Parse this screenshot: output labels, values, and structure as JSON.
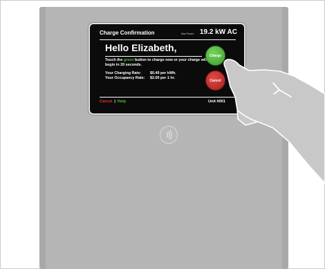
{
  "screen": {
    "title": "Charge Confirmation",
    "max_power_label": "Max Power:",
    "max_power_value": "19.2 kW AC",
    "greeting": "Hello Elizabeth,",
    "instruction_before": "Touch the ",
    "instruction_green": "green",
    "instruction_after": " button to charge now or your charge will begin in 20 seconds.",
    "charging_rate_label": "Your Charging Rate:",
    "charging_rate_value": "$0.49 per kWh.",
    "occupancy_rate_label": "Your Occupancy Rate:",
    "occupancy_rate_value": "$2.00 per 1 hr.",
    "charge_button": "Charge",
    "cancel_button": "Cancel",
    "footer_cancel": "Cancel",
    "footer_separator": "|",
    "footer_help": "Help",
    "unit": "Unit #001"
  },
  "colors": {
    "screen_bg": "#0b0b0b",
    "charge_green": "#4fbf3a",
    "cancel_red": "#e0332d",
    "kiosk_body": "#b5b5b5"
  },
  "icons": {
    "contactless": "contactless-icon",
    "hand": "hand-icon"
  }
}
